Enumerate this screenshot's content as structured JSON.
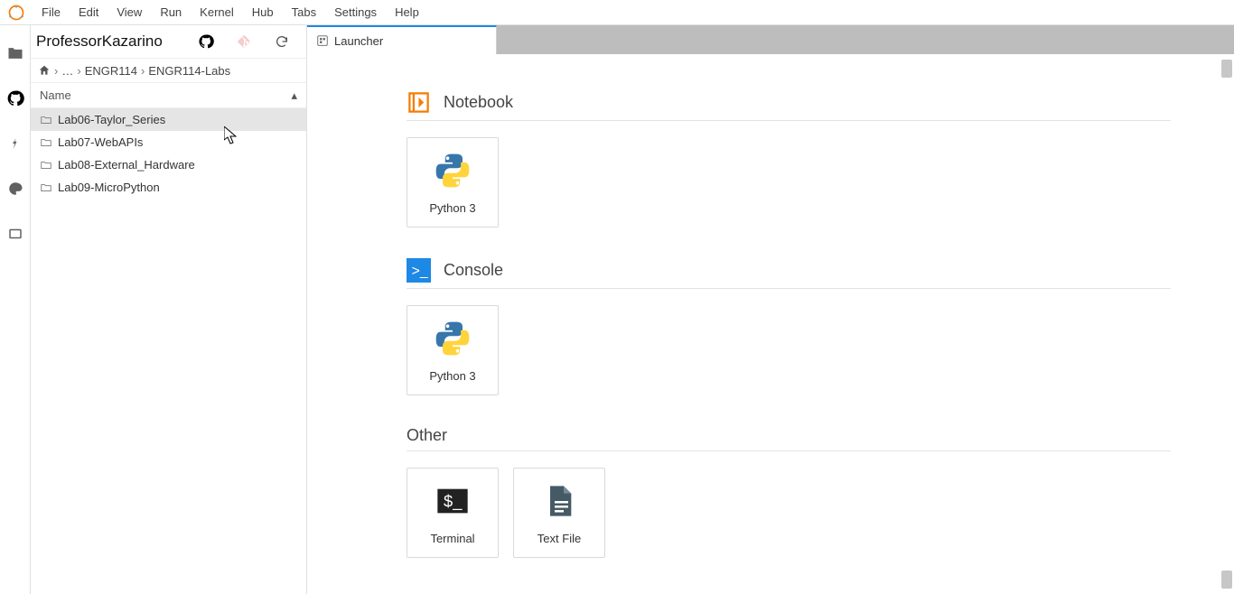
{
  "menu": [
    "File",
    "Edit",
    "View",
    "Run",
    "Kernel",
    "Hub",
    "Tabs",
    "Settings",
    "Help"
  ],
  "panel": {
    "title": "ProfessorKazarino",
    "breadcrumb": {
      "ellipsis": "…",
      "parts": [
        "ENGR114",
        "ENGR114-Labs"
      ]
    },
    "col_header": "Name",
    "files": [
      {
        "name": "Lab06-Taylor_Series",
        "selected": true
      },
      {
        "name": "Lab07-WebAPIs",
        "selected": false
      },
      {
        "name": "Lab08-External_Hardware",
        "selected": false
      },
      {
        "name": "Lab09-MicroPython",
        "selected": false
      }
    ]
  },
  "tab": {
    "label": "Launcher"
  },
  "launcher": {
    "notebook": {
      "title": "Notebook",
      "card": "Python 3"
    },
    "console": {
      "title": "Console",
      "card": "Python 3"
    },
    "other": {
      "title": "Other",
      "terminal": "Terminal",
      "textfile": "Text File"
    }
  }
}
